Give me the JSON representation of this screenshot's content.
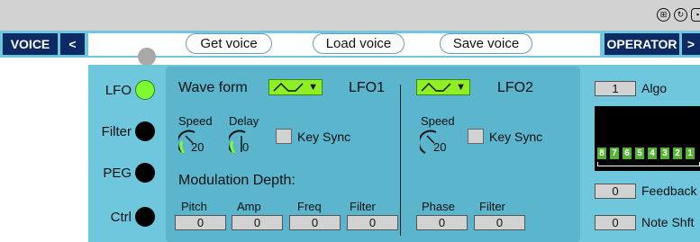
{
  "topbar": {
    "icons": [
      "grid-icon",
      "reload-icon",
      "save-icon"
    ]
  },
  "nav": {
    "voice_label": "VOICE",
    "voice_arrow": "<",
    "get_voice": "Get voice",
    "load_voice": "Load voice",
    "save_voice": "Save voice",
    "operator_label": "OPERATOR",
    "operator_arrow": ">"
  },
  "side": {
    "items": [
      {
        "label": "LFO",
        "active": true
      },
      {
        "label": "Filter",
        "active": false
      },
      {
        "label": "PEG",
        "active": false
      },
      {
        "label": "Ctrl",
        "active": false
      }
    ]
  },
  "lfo": {
    "wave_form_label": "Wave form",
    "lfo1_title": "LFO1",
    "lfo2_title": "LFO2",
    "wave_arrow": "▼",
    "speed_label": "Speed",
    "delay_label": "Delay",
    "key_sync_label": "Key Sync",
    "lfo1_speed": "20",
    "lfo1_delay": "0",
    "lfo2_speed": "20",
    "mod_depth_label": "Modulation Depth:",
    "pitch_label": "Pitch",
    "amp_label": "Amp",
    "freq_label": "Freq",
    "filter_label": "Filter",
    "phase_label": "Phase",
    "pitch_value": "0",
    "amp_value": "0",
    "freq_value": "0",
    "filter_value": "0",
    "phase_value": "0",
    "filter2_value": "0"
  },
  "right": {
    "algo_value": "1",
    "algo_label": "Algo",
    "operators": [
      "8",
      "7",
      "6",
      "5",
      "4",
      "3",
      "2",
      "1"
    ],
    "feedback_value": "0",
    "feedback_label": "Feedback",
    "note_shift_value": "0",
    "note_shift_label": "Note Shft"
  },
  "colors": {
    "panel": "#6fc7de",
    "lfo_box": "#5ab5cd",
    "nav_dark": "#0c2a63",
    "active_green": "#7cfa33",
    "wave_green": "#8ef024",
    "value_box": "#d2d2d2"
  }
}
